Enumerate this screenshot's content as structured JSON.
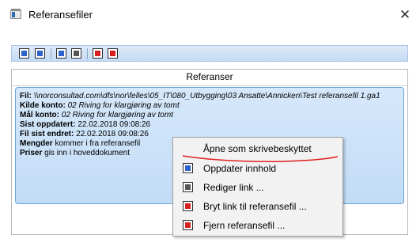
{
  "window": {
    "title": "Referansefiler",
    "close_glyph": "✕"
  },
  "toolbar": {
    "buttons": [
      {
        "icon": "add-reference-icon",
        "color": "#2c62c9"
      },
      {
        "icon": "import-reference-icon",
        "color": "#2c62c9"
      },
      {
        "icon": "update-content-icon",
        "color": "#2c62c9"
      },
      {
        "icon": "edit-link-icon",
        "color": "#2c62c9"
      },
      {
        "icon": "break-link-icon",
        "color": "#d62020"
      },
      {
        "icon": "remove-reference-icon",
        "color": "#d62020"
      }
    ]
  },
  "panel": {
    "header": "Referanser",
    "reference": {
      "file_label": "Fil:",
      "file_value": "\\\\norconsultad.com\\dfs\\nor\\felles\\05_IT\\080_Utbygging\\03 Ansatte\\Annicken\\Test referansefil 1.ga1",
      "source_account_label": "Kilde konto:",
      "source_account_value": "02 Riving for klargjøring av tomt",
      "target_account_label": "Mål konto:",
      "target_account_value": "02 Riving for klargjøring av tomt",
      "last_updated_label": "Sist oppdatert:",
      "last_updated_value": "22.02.2018 09:08:26",
      "last_modified_label": "Fil sist endret:",
      "last_modified_value": "22.02.2018 09:08:26",
      "quantities_label": "Mengder",
      "quantities_value": "kommer i fra referansefil",
      "prices_label": "Priser",
      "prices_value": "gis inn i hoveddokument"
    }
  },
  "context_menu": {
    "items": [
      {
        "label": "Åpne som skrivebeskyttet",
        "icon": ""
      },
      {
        "label": "Oppdater innhold",
        "icon": "update-content-icon"
      },
      {
        "label": "Rediger link ...",
        "icon": "edit-link-icon"
      },
      {
        "label": "Bryt link til referansefil ...",
        "icon": "break-link-icon"
      },
      {
        "label": "Fjern referansefil ...",
        "icon": "remove-reference-icon"
      }
    ]
  },
  "colors": {
    "accent": "#2c62c9",
    "danger": "#d62020",
    "card_border": "#6fa3d8",
    "annotation_red": "#e02020"
  }
}
